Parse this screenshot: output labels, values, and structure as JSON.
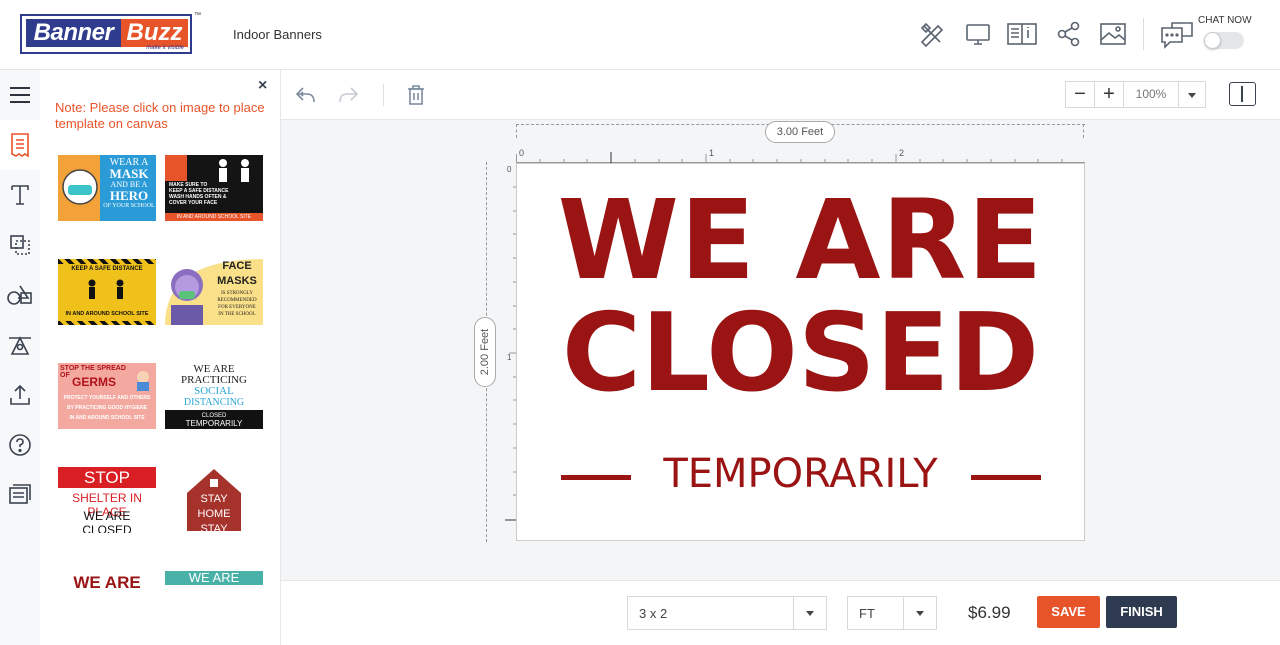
{
  "header": {
    "logo_left": "Banner",
    "logo_right": "Buzz",
    "logo_tagline": "make it visible",
    "logo_tm": "™",
    "title": "Indoor Banners",
    "icons": [
      "design-tools-icon",
      "preview-icon",
      "catalog-icon",
      "share-icon",
      "image-icon",
      "chat-icon"
    ],
    "chat_label": "CHAT NOW"
  },
  "rail": {
    "items": [
      "menu-icon",
      "templates-icon",
      "text-icon",
      "layers-icon",
      "shapes-icon",
      "clipart-icon",
      "upload-icon",
      "help-icon",
      "comments-icon"
    ],
    "active": "templates-icon"
  },
  "panel": {
    "close": "×",
    "note": "Note: Please click on image to place template on canvas",
    "templates": {
      "t1": {
        "lines": [
          "WEAR A",
          "MASK",
          "AND BE A",
          "HERO",
          "OF YOUR SCHOOL"
        ]
      },
      "t2": {
        "lines": [
          "MAKE SURE TO",
          "KEEP A SAFE DISTANCE",
          "WASH HANDS OFTEN &",
          "COVER YOUR FACE",
          "IN AND AROUND SCHOOL SITE"
        ]
      },
      "t3": {
        "lines": [
          "KEEP A SAFE DISTANCE",
          "IN AND AROUND SCHOOL SITE"
        ]
      },
      "t4": {
        "lines": [
          "FACE",
          "MASKS",
          "IS STRONGLY",
          "RECOMMENDED",
          "FOR EVERYONE",
          "IN THE SCHOOL"
        ]
      },
      "t5": {
        "lines": [
          "STOP THE SPREAD OF",
          "GERMS",
          "PROTECT YOURSELF AND OTHERS",
          "BY PRACTICING GOOD HYGIENE",
          "IN AND AROUND SCHOOL SITE"
        ]
      },
      "t6": {
        "lines": [
          "WE ARE",
          "PRACTICING",
          "SOCIAL",
          "DISTANCING",
          "CLOSED",
          "TEMPORARILY"
        ]
      },
      "t7": {
        "lines": [
          "STOP",
          "SHELTER IN PLACE",
          "WE ARE CLOSED"
        ]
      },
      "t8": {
        "lines": [
          "STAY HOME",
          "STAY SAFE"
        ]
      },
      "t9": {
        "lines": [
          "WE ARE"
        ]
      },
      "t10": {
        "lines": [
          "WE ARE"
        ]
      }
    }
  },
  "toolbar": {
    "zoom_minus": "−",
    "zoom_plus": "+",
    "zoom_value": "100%"
  },
  "canvas": {
    "width_label": "3.00 Feet",
    "height_label": "2.00 Feet",
    "ruler_h": [
      "0",
      "1",
      "2"
    ],
    "ruler_v": [
      "0",
      "1"
    ],
    "design": {
      "line1": "WE ARE",
      "line2": "CLOSED",
      "line3": "TEMPORARILY",
      "color": "#9a1414"
    }
  },
  "bottom": {
    "size_value": "3 x 2",
    "unit_value": "FT",
    "price": "$6.99",
    "save": "SAVE",
    "finish": "FINISH"
  },
  "colors": {
    "accent": "#e8542a",
    "brand_blue": "#2f3b8c",
    "finish_bg": "#2e3a4f"
  }
}
